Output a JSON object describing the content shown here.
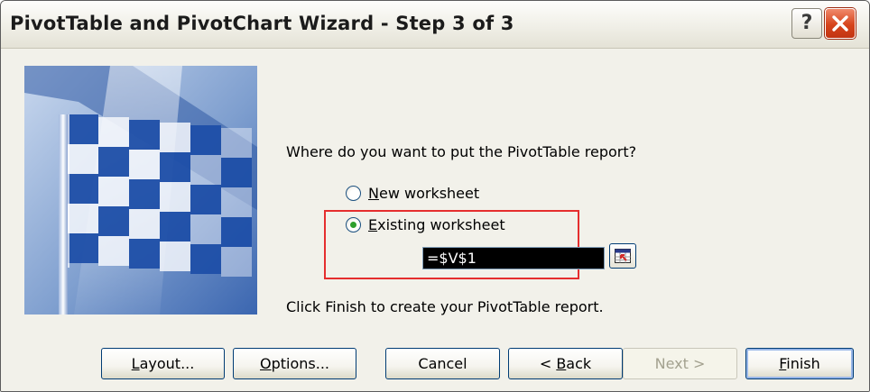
{
  "window": {
    "title": "PivotTable and PivotChart Wizard - Step 3 of 3",
    "help_label": "?"
  },
  "question": "Where do you want to put the PivotTable report?",
  "options": [
    {
      "label_pre": "",
      "mnemonic": "N",
      "label_post": "ew worksheet",
      "selected": false
    },
    {
      "label_pre": "",
      "mnemonic": "E",
      "label_post": "xisting worksheet",
      "selected": true
    }
  ],
  "location_input": {
    "value": "=$V$1"
  },
  "finish_note": "Click Finish to create your PivotTable report.",
  "buttons": [
    {
      "key": "layout",
      "pre": "",
      "mnemonic": "L",
      "post": "ayout...",
      "enabled": true
    },
    {
      "key": "options",
      "pre": "",
      "mnemonic": "O",
      "post": "ptions...",
      "enabled": true
    },
    {
      "key": "cancel",
      "pre": "Cancel",
      "mnemonic": "",
      "post": "",
      "enabled": true
    },
    {
      "key": "back",
      "pre": "< ",
      "mnemonic": "B",
      "post": "ack",
      "enabled": true
    },
    {
      "key": "next",
      "pre": "Next >",
      "mnemonic": "",
      "post": "",
      "enabled": false
    },
    {
      "key": "finish",
      "pre": "",
      "mnemonic": "F",
      "post": "inish",
      "enabled": true
    }
  ],
  "colors": {
    "dialog_bg": "#ece9d8",
    "highlight_box": "#e52e2e",
    "close_button": "#d6441c",
    "selected_radio": "#2d9f2d"
  },
  "icons": [
    "help-icon",
    "close-icon",
    "checkered-flag-icon",
    "collapse-dialog-icon"
  ]
}
